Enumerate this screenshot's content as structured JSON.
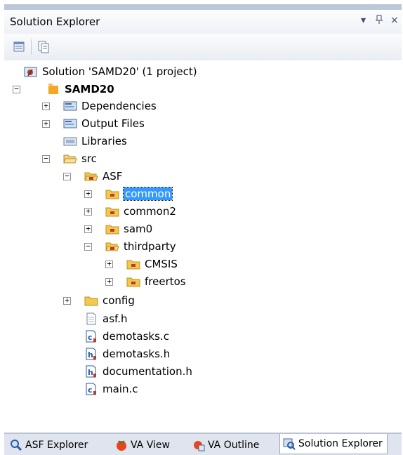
{
  "window": {
    "title": "Solution Explorer",
    "controls": {
      "dropdown": "▾",
      "pin": "ᚔ",
      "close": "×"
    }
  },
  "tree": {
    "solution": "Solution 'SAMD20' (1 project)",
    "project": "SAMD20",
    "dependencies": "Dependencies",
    "output_files": "Output Files",
    "libraries": "Libraries",
    "src": "src",
    "asf": "ASF",
    "common": "common",
    "common2": "common2",
    "sam0": "sam0",
    "thirdparty": "thirdparty",
    "cmsis": "CMSIS",
    "freertos": "freertos",
    "config": "config",
    "asf_h": "asf.h",
    "demotasks_c": "demotasks.c",
    "demotasks_h": "demotasks.h",
    "documentation_h": "documentation.h",
    "main_c": "main.c",
    "selected": "common"
  },
  "tabs": {
    "asf_explorer": "ASF Explorer",
    "va_view": "VA View",
    "va_outline": "VA Outline",
    "solution_explorer": "Solution Explorer",
    "active": "Solution Explorer"
  },
  "colors": {
    "selection": "#3399ff",
    "folder": "#f2c94c",
    "project": "#f5a623"
  }
}
